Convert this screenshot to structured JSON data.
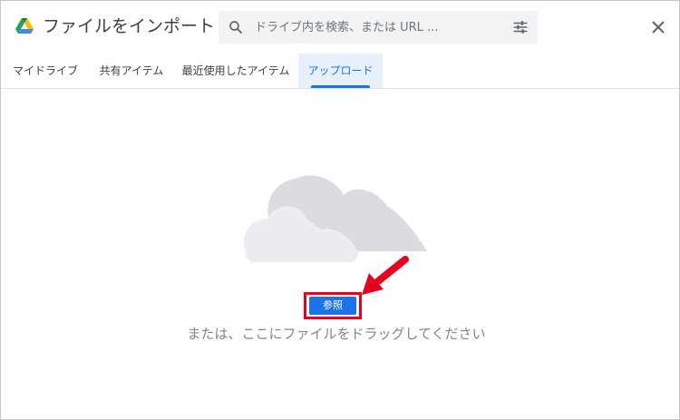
{
  "header": {
    "title": "ファイルをインポート",
    "logo_icon": "google-drive-logo"
  },
  "search": {
    "placeholder": "ドライブ内を検索、または URL ...",
    "value": "",
    "icon": "search-icon",
    "filter_icon": "tune-icon"
  },
  "close_icon": "close-icon",
  "tabs": [
    {
      "label": "マイドライブ",
      "active": false
    },
    {
      "label": "共有アイテム",
      "active": false
    },
    {
      "label": "最近使用したアイテム",
      "active": false
    },
    {
      "label": "アップロード",
      "active": true
    }
  ],
  "upload": {
    "illustration_icon": "cloud-illustration-icon",
    "browse_label": "参照",
    "drop_hint": "または、ここにファイルをドラッグしてください"
  },
  "annotation": {
    "arrow_icon": "red-arrow-icon",
    "highlight_color": "#e8001f"
  },
  "colors": {
    "accent": "#1a73e8",
    "active_tab_bg": "#e8f0fe",
    "search_bg": "#f1f3f4"
  }
}
